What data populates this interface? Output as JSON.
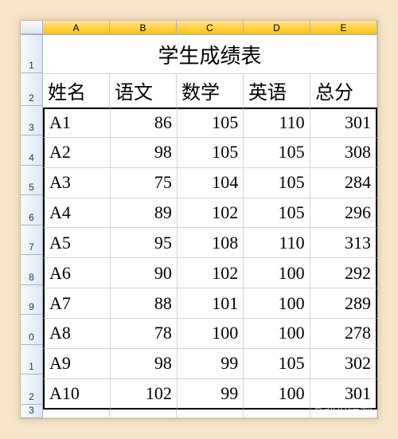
{
  "columns": [
    "A",
    "B",
    "C",
    "D",
    "E"
  ],
  "rowNumbers": [
    "1",
    "2",
    "3",
    "4",
    "5",
    "6",
    "7",
    "8",
    "9",
    "0",
    "1",
    "2",
    "3"
  ],
  "title": "学生成绩表",
  "headers": [
    "姓名",
    "语文",
    "数学",
    "英语",
    "总分"
  ],
  "rows": [
    {
      "name": "A1",
      "chinese": 86,
      "math": 105,
      "english": 110,
      "total": 301
    },
    {
      "name": "A2",
      "chinese": 98,
      "math": 105,
      "english": 105,
      "total": 308
    },
    {
      "name": "A3",
      "chinese": 75,
      "math": 104,
      "english": 105,
      "total": 284
    },
    {
      "name": "A4",
      "chinese": 89,
      "math": 102,
      "english": 105,
      "total": 296
    },
    {
      "name": "A5",
      "chinese": 95,
      "math": 108,
      "english": 110,
      "total": 313
    },
    {
      "name": "A6",
      "chinese": 90,
      "math": 102,
      "english": 100,
      "total": 292
    },
    {
      "name": "A7",
      "chinese": 88,
      "math": 101,
      "english": 100,
      "total": 289
    },
    {
      "name": "A8",
      "chinese": 78,
      "math": 100,
      "english": 100,
      "total": 278
    },
    {
      "name": "A9",
      "chinese": 98,
      "math": 99,
      "english": 105,
      "total": 302
    },
    {
      "name": "A10",
      "chinese": 102,
      "math": 99,
      "english": 100,
      "total": 301
    }
  ],
  "chart_data": {
    "type": "table",
    "title": "学生成绩表",
    "columns": [
      "姓名",
      "语文",
      "数学",
      "英语",
      "总分"
    ],
    "data": [
      [
        "A1",
        86,
        105,
        110,
        301
      ],
      [
        "A2",
        98,
        105,
        105,
        308
      ],
      [
        "A3",
        75,
        104,
        105,
        284
      ],
      [
        "A4",
        89,
        102,
        105,
        296
      ],
      [
        "A5",
        95,
        108,
        110,
        313
      ],
      [
        "A6",
        90,
        102,
        100,
        292
      ],
      [
        "A7",
        88,
        101,
        100,
        289
      ],
      [
        "A8",
        78,
        100,
        100,
        278
      ],
      [
        "A9",
        98,
        99,
        105,
        302
      ],
      [
        "A10",
        102,
        99,
        100,
        301
      ]
    ]
  },
  "watermark": "Baidu经验"
}
